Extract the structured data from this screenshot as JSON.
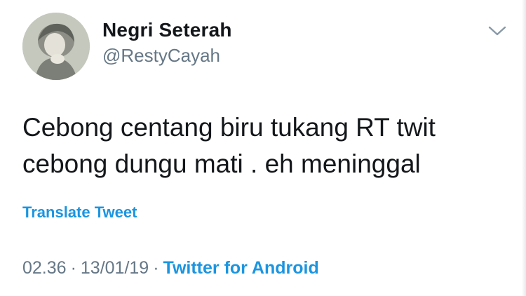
{
  "user": {
    "display_name": "Negri Seterah",
    "handle": "@RestyCayah"
  },
  "tweet": {
    "lines": [
      "Cebong centang biru tukang RT twit",
      "cebong dungu mati . eh meninggal"
    ]
  },
  "actions": {
    "translate_label": "Translate Tweet",
    "menu_icon": "chevron-down-icon"
  },
  "meta": {
    "time": "02.36",
    "date": "13/01/19",
    "separator": "·",
    "source": "Twitter for Android"
  },
  "colors": {
    "text": "#14171a",
    "secondary": "#657786",
    "link": "#1b95e0"
  }
}
